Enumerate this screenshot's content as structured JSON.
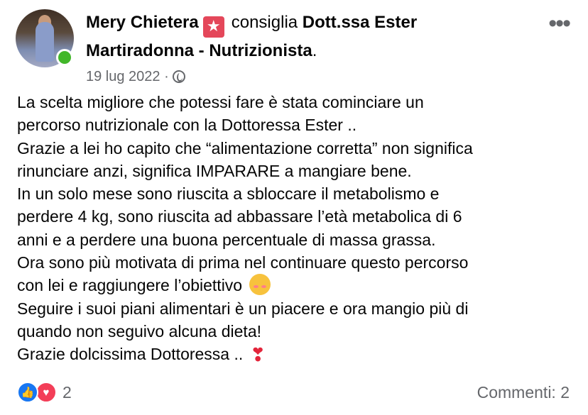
{
  "post": {
    "author": "Mery Chietera",
    "action": "consiglia",
    "page_name_part1": "Dott.ssa Ester",
    "page_name_part2": "Martiradonna - Nutrizionista",
    "page_name_suffix": ".",
    "date": "19 lug 2022",
    "separator": "·",
    "more_label": "•••",
    "body_lines": [
      "La scelta migliore che potessi fare è stata cominciare un",
      "percorso nutrizionale con la Dottoressa Ester ..",
      "Grazie a lei ho capito che “alimentazione corretta” non significa",
      "rinunciare anzi, significa IMPARARE a mangiare bene.",
      "In un solo mese sono riuscita a sbloccare il metabolismo e",
      "perdere 4 kg, sono riuscita ad abbassare l’età metabolica di 6",
      "anni e a perdere una buona percentuale di massa grassa.",
      "Ora sono più motivata di prima nel continuare questo percorso",
      "con lei e raggiungere l’obiettivo",
      "Seguire i suoi piani alimentari è un piacere e ora mangio più di",
      "quando non seguivo alcuna dieta!",
      "Grazie dolcissima Dottoressa .."
    ],
    "heart_glyph": "❣"
  },
  "footer": {
    "like_glyph": "👍",
    "love_glyph": "♥",
    "reaction_count": "2",
    "comments_label": "Commenti: 2"
  },
  "icons": {
    "recommend_badge": "star-badge-icon",
    "privacy": "globe-icon",
    "more": "more-options-icon"
  },
  "colors": {
    "recommend_badge": "#e4475a",
    "online": "#42b72a",
    "like": "#1877f2",
    "love": "#f33e58",
    "secondary_text": "#65676b"
  }
}
